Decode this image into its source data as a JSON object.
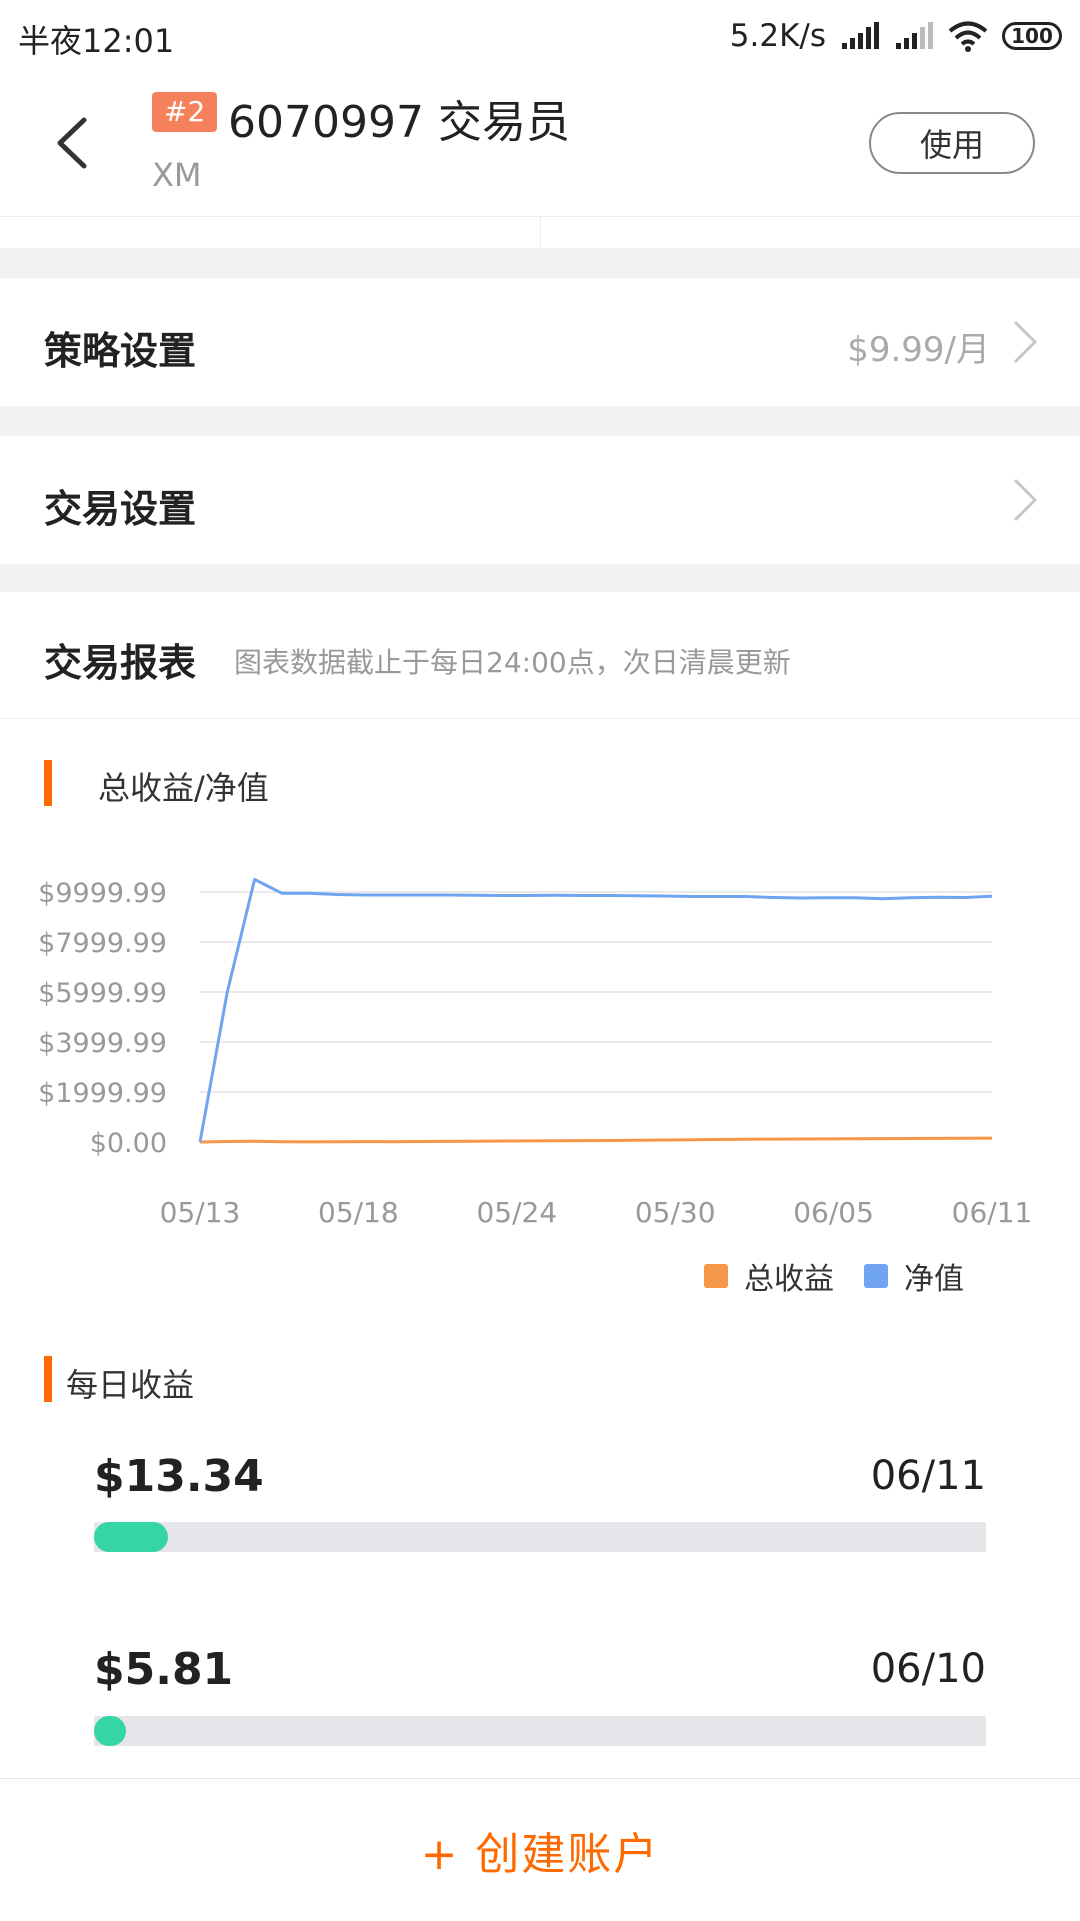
{
  "status_bar": {
    "time": "半夜12:01",
    "net_speed": "5.2K/s",
    "battery": "100",
    "icons": [
      "signal-icon",
      "signal-icon-2",
      "wifi-icon",
      "battery-icon"
    ]
  },
  "header": {
    "rank": "#2",
    "title": "6070997 交易员",
    "broker": "XM",
    "use_label": "使用",
    "back_icon": "back-arrow-icon"
  },
  "strategy": {
    "label": "策略设置",
    "price": "$9.99/月"
  },
  "trade_settings": {
    "label": "交易设置"
  },
  "report": {
    "title": "交易报表",
    "note": "图表数据截止于每日24:00点，次日清晨更新"
  },
  "chart_section": {
    "title": "总收益/净值"
  },
  "chart_data": {
    "type": "line",
    "title": "总收益/净值",
    "x_ticks": [
      "05/13",
      "05/18",
      "05/24",
      "05/30",
      "06/05",
      "06/11"
    ],
    "y_ticks": [
      "$0.00",
      "$1999.99",
      "$3999.99",
      "$5999.99",
      "$7999.99",
      "$9999.99"
    ],
    "ylim": [
      0,
      9999.99
    ],
    "grid": true,
    "legend_position": "bottom-right",
    "series": [
      {
        "name": "总收益",
        "color": "#f5984a",
        "values": [
          0,
          20,
          30,
          10,
          5,
          10,
          15,
          10,
          20,
          25,
          30,
          40,
          45,
          50,
          55,
          60,
          70,
          80,
          90,
          100,
          110,
          115,
          120,
          125,
          130,
          135,
          140,
          145,
          150,
          155
        ]
      },
      {
        "name": "净值",
        "color": "#6fa4f0",
        "values": [
          0,
          6000,
          10500,
          9950,
          9950,
          9900,
          9880,
          9880,
          9880,
          9880,
          9870,
          9860,
          9860,
          9870,
          9860,
          9860,
          9850,
          9840,
          9820,
          9820,
          9820,
          9780,
          9760,
          9770,
          9770,
          9730,
          9770,
          9790,
          9780,
          9830
        ]
      }
    ]
  },
  "daily_section": {
    "title": "每日收益"
  },
  "daily_items": [
    {
      "amount": "$13.34",
      "date": "06/11",
      "fraction": 0.083
    },
    {
      "amount": "$5.81",
      "date": "06/10",
      "fraction": 0.036
    }
  ],
  "bottom": {
    "create_label": "+ 创建账户"
  },
  "colors": {
    "accent": "#ff6a00",
    "profit_bar": "#35d5a6",
    "rank_badge": "#f4815a"
  }
}
